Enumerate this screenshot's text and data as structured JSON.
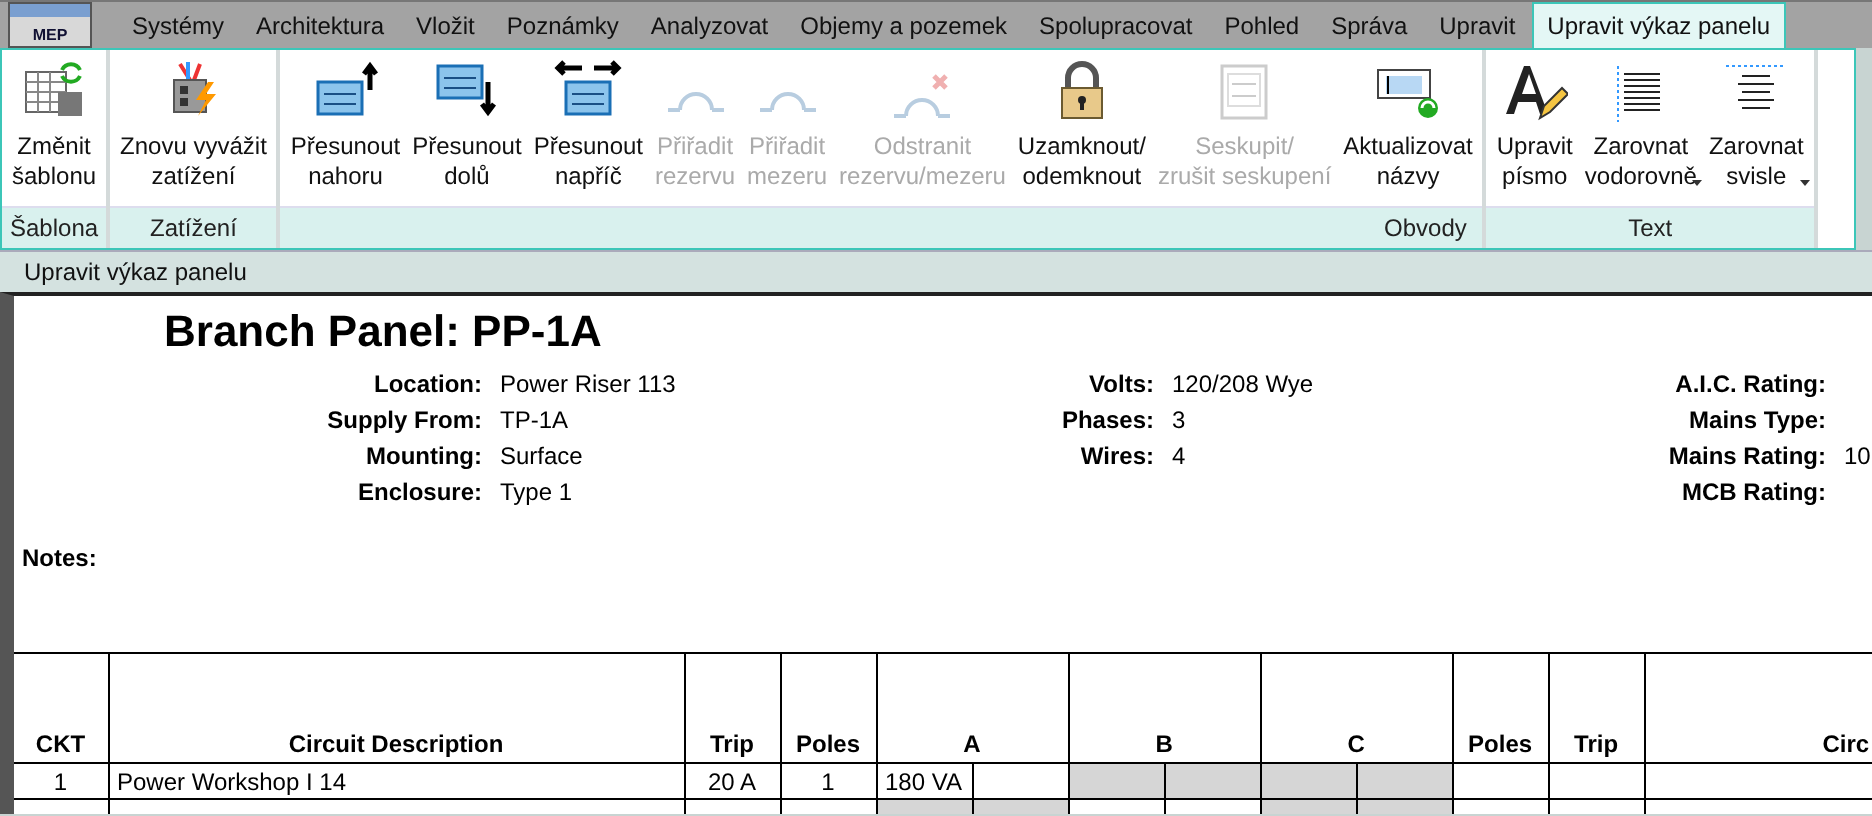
{
  "app_button": "MEP",
  "tabs": [
    {
      "label": "Systémy",
      "selected": false
    },
    {
      "label": "Architektura",
      "selected": false
    },
    {
      "label": "Vložit",
      "selected": false
    },
    {
      "label": "Poznámky",
      "selected": false
    },
    {
      "label": "Analyzovat",
      "selected": false
    },
    {
      "label": "Objemy a pozemek",
      "selected": false
    },
    {
      "label": "Spolupracovat",
      "selected": false
    },
    {
      "label": "Pohled",
      "selected": false
    },
    {
      "label": "Správa",
      "selected": false
    },
    {
      "label": "Upravit",
      "selected": false
    },
    {
      "label": "Upravit výkaz panelu",
      "selected": true
    }
  ],
  "ribbon_groups": [
    {
      "title": "Šablona",
      "buttons": [
        {
          "label": "Změnit\nšablonu",
          "disabled": false,
          "dropdown": false
        }
      ]
    },
    {
      "title": "Zatížení",
      "buttons": [
        {
          "label": "Znovu vyvážit\nzatížení",
          "disabled": false,
          "dropdown": false
        }
      ]
    },
    {
      "title": "Obvody",
      "buttons": [
        {
          "label": "Přesunout\nnahoru",
          "disabled": false,
          "dropdown": false
        },
        {
          "label": "Přesunout\ndolů",
          "disabled": false,
          "dropdown": false
        },
        {
          "label": "Přesunout\nnapříč",
          "disabled": false,
          "dropdown": false
        },
        {
          "label": "Přiřadit\nrezervu",
          "disabled": true,
          "dropdown": false
        },
        {
          "label": "Přiřadit\nmezeru",
          "disabled": true,
          "dropdown": false
        },
        {
          "label": "Odstranit\nrezervu/mezeru",
          "disabled": true,
          "dropdown": false
        },
        {
          "label": "Uzamknout/\nodemknout",
          "disabled": false,
          "dropdown": false
        },
        {
          "label": "Seskupit/\nzrušit seskupení",
          "disabled": true,
          "dropdown": false
        },
        {
          "label": "Aktualizovat\nnázvy",
          "disabled": false,
          "dropdown": false
        }
      ]
    },
    {
      "title": "Text",
      "buttons": [
        {
          "label": "Upravit\npísmo",
          "disabled": false,
          "dropdown": false
        },
        {
          "label": "Zarovnat\nvodorovně",
          "disabled": false,
          "dropdown": true
        },
        {
          "label": "Zarovnat\nsvisle",
          "disabled": false,
          "dropdown": true
        }
      ]
    }
  ],
  "context_bar": "Upravit výkaz panelu",
  "schedule": {
    "title": "Branch Panel: PP-1A",
    "info_columns": [
      [
        {
          "label": "Location:",
          "value": "Power Riser 113"
        },
        {
          "label": "Supply From:",
          "value": "TP-1A"
        },
        {
          "label": "Mounting:",
          "value": "Surface"
        },
        {
          "label": "Enclosure:",
          "value": "Type 1"
        }
      ],
      [
        {
          "label": "Volts:",
          "value": "120/208 Wye"
        },
        {
          "label": "Phases:",
          "value": "3"
        },
        {
          "label": "Wires:",
          "value": "4"
        }
      ],
      [
        {
          "label": "A.I.C. Rating:"
        },
        {
          "label": "Mains Type:"
        },
        {
          "label": "Mains Rating:",
          "value": "10"
        },
        {
          "label": "MCB Rating:"
        }
      ]
    ],
    "notes_label": "Notes:",
    "columns": [
      "CKT",
      "Circuit Description",
      "Trip",
      "Poles",
      "A",
      "B",
      "C",
      "Poles",
      "Trip",
      "Circ"
    ],
    "rows": [
      {
        "ckt": "1",
        "description": "Power Workshop I 14",
        "trip": "20 A",
        "poles": "1",
        "phase_cells": [
          {
            "shaded": false,
            "left": "180 VA"
          },
          {
            "shaded": true
          },
          {
            "shaded": true
          }
        ]
      },
      {
        "phase_cells": [
          {
            "shaded": true
          },
          {
            "shaded": false
          },
          {
            "shaded": true
          }
        ]
      }
    ]
  }
}
